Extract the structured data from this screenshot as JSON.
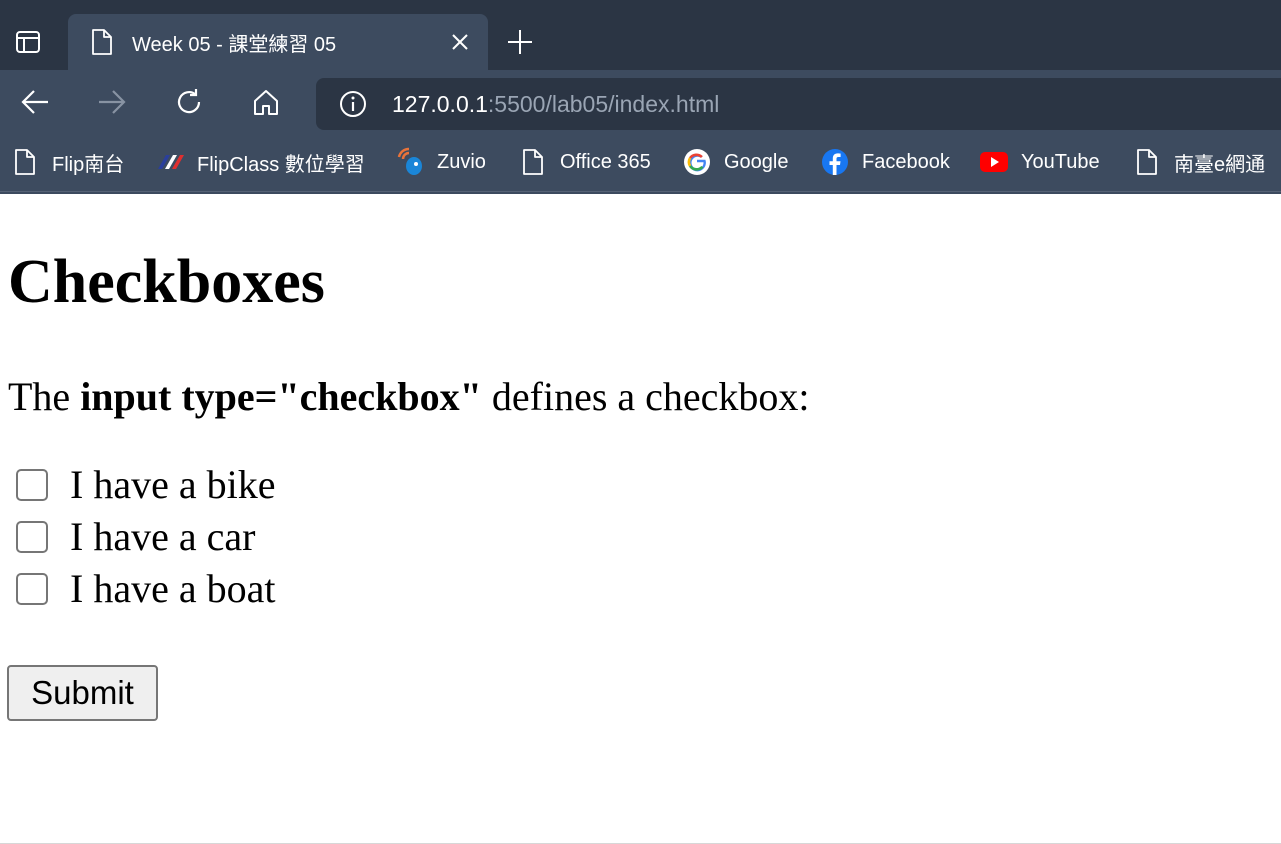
{
  "tab": {
    "title": "Week 05 - 課堂練習 05"
  },
  "address_bar": {
    "host": "127.0.0.1",
    "rest": ":5500/lab05/index.html"
  },
  "bookmarks": [
    {
      "label": "Flip南台",
      "icon": "document-icon"
    },
    {
      "label": "FlipClass 數位學習",
      "icon": "flipclass-icon"
    },
    {
      "label": "Zuvio",
      "icon": "zuvio-icon"
    },
    {
      "label": "Office 365",
      "icon": "document-icon"
    },
    {
      "label": "Google",
      "icon": "google-icon"
    },
    {
      "label": "Facebook",
      "icon": "facebook-icon"
    },
    {
      "label": "YouTube",
      "icon": "youtube-icon"
    },
    {
      "label": "南臺e網通",
      "icon": "document-icon"
    }
  ],
  "page": {
    "heading": "Checkboxes",
    "intro_prefix": "The",
    "intro_bold": "input type=\"checkbox\"",
    "intro_suffix": "defines a checkbox:",
    "checkboxes": [
      {
        "label": "I have a bike",
        "checked": false
      },
      {
        "label": "I have a car",
        "checked": false
      },
      {
        "label": "I have a boat",
        "checked": false
      }
    ],
    "submit_label": "Submit"
  },
  "colors": {
    "tabstrip": "#2b3544",
    "toolbar": "#3d4b5f",
    "address_field": "#2b3544",
    "url_dim": "#9aa5b4",
    "button_bg": "#efefef"
  }
}
